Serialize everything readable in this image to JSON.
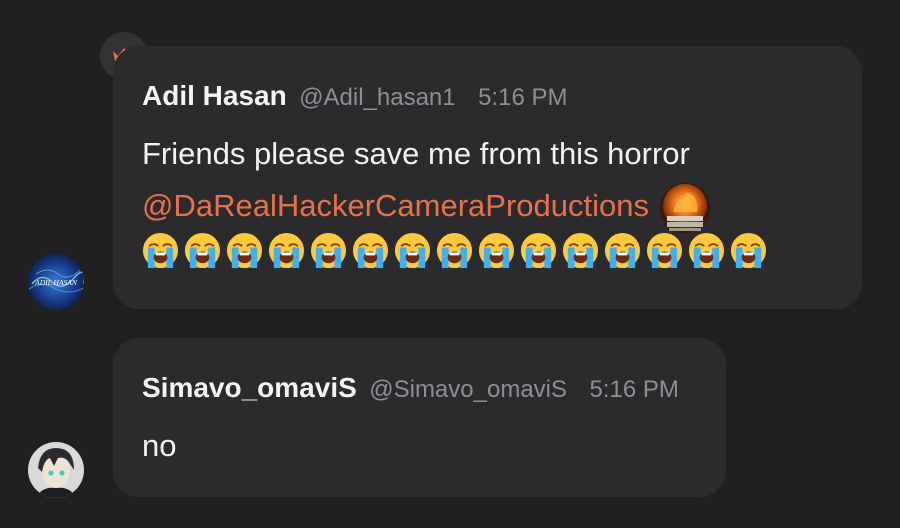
{
  "messages": [
    {
      "author": "Adil Hasan",
      "handle": "@Adil_hasan1",
      "time": "5:16 PM",
      "text_line_1": "Friends please save me from this horror",
      "mention": "@DaRealHackerCameraProductions",
      "emoji": "loudly-crying-face",
      "emoji_count": 15,
      "avatar_label": "ADIL HASAN",
      "badge_icon": "crown-icon"
    },
    {
      "author": "Simavo_omaviS",
      "handle": "@Simavo_omaviS",
      "time": "5:16 PM",
      "text_line_1": "no"
    }
  ],
  "colors": {
    "background": "#202020",
    "bubble": "#2b2b2d",
    "mention": "#e8704a",
    "muted": "#8e8e93",
    "crown": "#e8704a"
  }
}
